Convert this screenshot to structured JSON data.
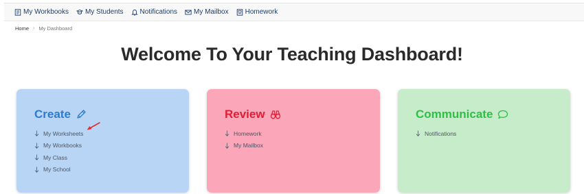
{
  "colors": {
    "nav_text": "#1a3d6e",
    "create": "#2a7bd1",
    "review": "#e21d32",
    "communicate": "#2ebf46",
    "create_bg": "#b9d5f5",
    "review_bg": "#fca6ba",
    "communicate_bg": "#c7ecc9",
    "pointer": "#e12c2c"
  },
  "nav": {
    "items": [
      {
        "label": "My Workbooks",
        "icon": "workbook-icon"
      },
      {
        "label": "My Students",
        "icon": "students-icon"
      },
      {
        "label": "Notifications",
        "icon": "bell-icon"
      },
      {
        "label": "My Mailbox",
        "icon": "mail-icon"
      },
      {
        "label": "Homework",
        "icon": "homework-icon"
      }
    ]
  },
  "breadcrumb": {
    "home": "Home",
    "separator": "›",
    "current": "My Dashboard"
  },
  "page": {
    "title": "Welcome To Your Teaching Dashboard!"
  },
  "cards": [
    {
      "title": "Create",
      "icon": "pencil-icon",
      "links": [
        "My Worksheets",
        "My Workbooks",
        "My Class",
        "My School"
      ]
    },
    {
      "title": "Review",
      "icon": "binoculars-icon",
      "links": [
        "Homework",
        "My Mailbox"
      ]
    },
    {
      "title": "Communicate",
      "icon": "speech-bubble-icon",
      "links": [
        "Notifications"
      ]
    }
  ]
}
